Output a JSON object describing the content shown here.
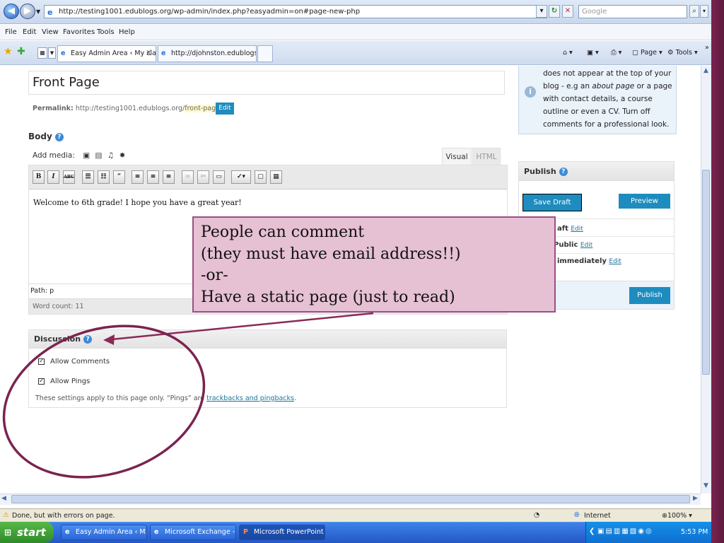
{
  "browser": {
    "url": "http://testing1001.edublogs.org/wp-admin/index.php?easyadmin=on#page-new-php",
    "search_placeholder": "Google",
    "menu": [
      "File",
      "Edit",
      "View",
      "Favorites",
      "Tools",
      "Help"
    ],
    "tabs": [
      {
        "label": "Easy Admin Area ‹ My cla..."
      },
      {
        "label": "http://djohnston.edublogs.org/"
      }
    ],
    "tab_close": "X",
    "right_tools": {
      "page": "Page",
      "tools": "Tools"
    },
    "status": {
      "text": "Done, but with errors on page.",
      "zone": "Internet",
      "zoom": "100%"
    }
  },
  "editor": {
    "title": "Front Page",
    "permalink_label": "Permalink:",
    "permalink_base": "http://testing1001.edublogs.org/",
    "permalink_slug": "front-page/",
    "permalink_edit": "Edit",
    "body_label": "Body",
    "add_media_label": "Add media:",
    "tab_visual": "Visual",
    "tab_html": "HTML",
    "toolbar": {
      "bold": "B",
      "italic": "I",
      "strike": "ABC",
      "quote": "“"
    },
    "content": "Welcome to 6th grade! I hope you have a great year!",
    "path_label": "Path: p",
    "word_count": "Word count: 11"
  },
  "discussion": {
    "title": "Discussion",
    "allow_comments": "Allow Comments",
    "allow_pings": "Allow Pings",
    "note_prefix": "These settings apply to this page only. “Pings” are ",
    "note_link": "trackbacks and pingbacks",
    "note_suffix": "."
  },
  "help_box": {
    "line1": "does not appear at the top of your",
    "line2_a": "blog - e.g an ",
    "line2_em": "about page",
    "line2_b": " or a page",
    "line3": "with contact details, a course",
    "line4": "outline or even a CV. Turn off",
    "line5": "comments for a professional look."
  },
  "publish": {
    "title": "Publish",
    "save_draft": "Save Draft",
    "preview": "Preview",
    "status_frag": "aft",
    "visibility_frag": "Public",
    "schedule_frag": "immediately",
    "edit": "Edit",
    "publish": "Publish"
  },
  "callout": {
    "line1": "People can comment",
    "line2": "(they must have email address!!)",
    "line3": "-or-",
    "line4": "Have a static page (just to read)"
  },
  "taskbar": {
    "start": "start",
    "tasks": [
      "Easy Admin Area ‹ M...",
      "Microsoft Exchange - ...",
      "Microsoft PowerPoint ..."
    ],
    "clock": "5:53 PM"
  },
  "colors": {
    "accent_blue": "#21759b",
    "button_blue": "#1e8cbe",
    "callout_fill": "#e6c0d3",
    "annotation": "#8a2a55"
  }
}
